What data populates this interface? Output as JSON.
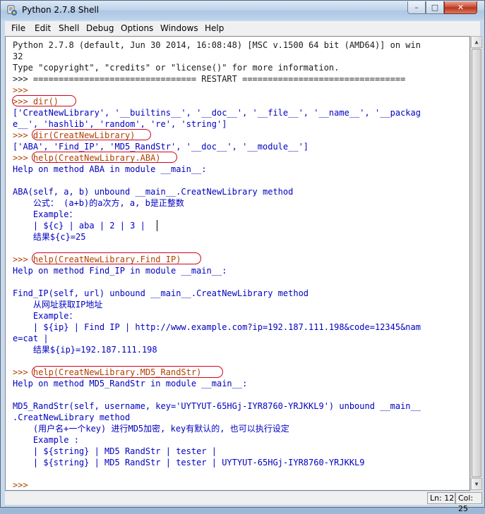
{
  "window": {
    "title": "Python 2.7.8 Shell",
    "controls": {
      "minimize": "–",
      "maximize": "□",
      "close": "✕"
    }
  },
  "menu": [
    "File",
    "Edit",
    "Shell",
    "Debug",
    "Options",
    "Windows",
    "Help"
  ],
  "console_lines": [
    {
      "text": "Python 2.7.8 (default, Jun 30 2014, 16:08:48) [MSC v.1500 64 bit (AMD64)] on win",
      "style": "out"
    },
    {
      "text": "32",
      "style": "out"
    },
    {
      "text": "Type \"copyright\", \"credits\" or \"license()\" for more information.",
      "style": "out"
    },
    {
      "text": ">>> ================================ RESTART ================================",
      "style": "out"
    },
    {
      "text": ">>> ",
      "style": "prompt"
    },
    {
      "text": ">>> dir()",
      "style": "prompt"
    },
    {
      "text": "['CreatNewLibrary', '__builtins__', '__doc__', '__file__', '__name__', '__packag",
      "style": "blue"
    },
    {
      "text": "e__', 'hashlib', 'random', 're', 'string']",
      "style": "blue"
    },
    {
      "text": ">>> dir(CreatNewLibrary)",
      "style": "prompt"
    },
    {
      "text": "['ABA', 'Find_IP', 'MD5_RandStr', '__doc__', '__module__']",
      "style": "blue"
    },
    {
      "text": ">>> help(CreatNewLibrary.ABA)",
      "style": "prompt"
    },
    {
      "text": "Help on method ABA in module __main__:",
      "style": "blue"
    },
    {
      "text": "",
      "style": "blue"
    },
    {
      "text": "ABA(self, a, b) unbound __main__.CreatNewLibrary method",
      "style": "blue"
    },
    {
      "text": "    公式： (a+b)的a次方, a, b是正整数",
      "style": "blue"
    },
    {
      "text": "    Example：",
      "style": "blue"
    },
    {
      "text": "    | ${c} | aba | 2 | 3 |",
      "style": "blue"
    },
    {
      "text": "    结果${c}=25",
      "style": "blue"
    },
    {
      "text": "",
      "style": "blue"
    },
    {
      "text": ">>> help(CreatNewLibrary.Find_IP)",
      "style": "prompt"
    },
    {
      "text": "Help on method Find_IP in module __main__:",
      "style": "blue"
    },
    {
      "text": "",
      "style": "blue"
    },
    {
      "text": "Find_IP(self, url) unbound __main__.CreatNewLibrary method",
      "style": "blue"
    },
    {
      "text": "    从网址获取IP地址",
      "style": "blue"
    },
    {
      "text": "    Example：",
      "style": "blue"
    },
    {
      "text": "    | ${ip} | Find IP | http://www.example.com?ip=192.187.111.198&code=12345&nam",
      "style": "blue"
    },
    {
      "text": "e=cat |",
      "style": "blue"
    },
    {
      "text": "    结果${ip}=192.187.111.198",
      "style": "blue"
    },
    {
      "text": "",
      "style": "blue"
    },
    {
      "text": ">>> help(CreatNewLibrary.MD5_RandStr)",
      "style": "prompt"
    },
    {
      "text": "Help on method MD5_RandStr in module __main__:",
      "style": "blue"
    },
    {
      "text": "",
      "style": "blue"
    },
    {
      "text": "MD5_RandStr(self, username, key='UYTYUT-65HGj-IYR8760-YRJKKL9') unbound __main__",
      "style": "blue"
    },
    {
      "text": ".CreatNewLibrary method",
      "style": "blue"
    },
    {
      "text": "    (用户名+一个key) 进行MD5加密, key有默认的, 也可以执行设定",
      "style": "blue"
    },
    {
      "text": "    Example :",
      "style": "blue"
    },
    {
      "text": "    | ${string} | MD5 RandStr | tester |",
      "style": "blue"
    },
    {
      "text": "    | ${string} | MD5 RandStr | tester | UYTYUT-65HGj-IYR8760-YRJKKL9",
      "style": "blue"
    },
    {
      "text": "",
      "style": "blue"
    },
    {
      "text": ">>> ",
      "style": "prompt"
    }
  ],
  "status": {
    "line": "Ln: 12",
    "column": "Col: 25"
  },
  "colors": {
    "prompt": "#b04000",
    "output": "#0000c0",
    "highlight": "#d0021b"
  }
}
